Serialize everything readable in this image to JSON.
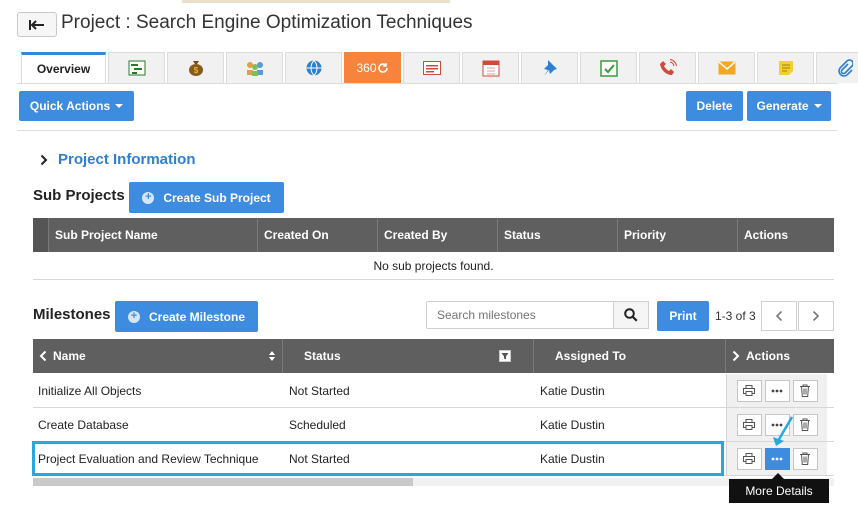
{
  "header": {
    "title": "Project : Search Engine Optimization Techniques"
  },
  "tabs": {
    "overview": "Overview",
    "badge_360": "360"
  },
  "toolbar": {
    "quick_actions": "Quick Actions",
    "delete": "Delete",
    "generate": "Generate"
  },
  "project_info": {
    "label": "Project Information"
  },
  "sub_projects": {
    "title": "Sub Projects",
    "create_button": "Create Sub Project",
    "columns": [
      "Sub Project Name",
      "Created On",
      "Created By",
      "Status",
      "Priority",
      "Actions"
    ],
    "empty_text": "No sub projects found."
  },
  "milestones": {
    "title": "Milestones",
    "create_button": "Create Milestone",
    "search_placeholder": "Search milestones",
    "print": "Print",
    "pager_text": "1-3 of 3",
    "columns": {
      "name": "Name",
      "status": "Status",
      "assigned_to": "Assigned To",
      "actions": "Actions"
    },
    "rows": [
      {
        "name": "Initialize All Objects",
        "status": "Not Started",
        "assigned_to": "Katie Dustin"
      },
      {
        "name": "Create Database",
        "status": "Scheduled",
        "assigned_to": "Katie Dustin"
      },
      {
        "name": "Project Evaluation and Review Technique",
        "status": "Not Started",
        "assigned_to": "Katie Dustin"
      }
    ],
    "tooltip": "More Details"
  },
  "colors": {
    "accent": "#3d8ce0",
    "orange_tab": "#f6843c",
    "header_bg": "#5f5f5f",
    "highlight": "#29a7dd"
  }
}
